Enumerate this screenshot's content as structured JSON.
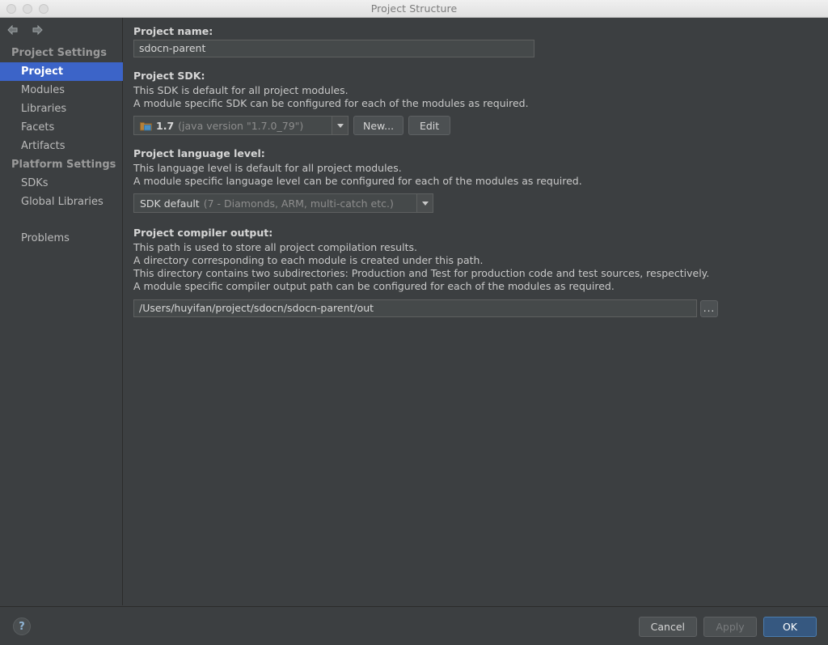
{
  "window": {
    "title": "Project Structure",
    "traffic_lights": [
      "close-button",
      "minimize-button",
      "zoom-button"
    ]
  },
  "nav": {
    "back_label": "Back",
    "forward_label": "Forward"
  },
  "sidebar": {
    "groups": [
      {
        "label": "Project Settings",
        "items": [
          {
            "label": "Project",
            "selected": true
          },
          {
            "label": "Modules",
            "selected": false
          },
          {
            "label": "Libraries",
            "selected": false
          },
          {
            "label": "Facets",
            "selected": false
          },
          {
            "label": "Artifacts",
            "selected": false
          }
        ]
      },
      {
        "label": "Platform Settings",
        "items": [
          {
            "label": "SDKs",
            "selected": false
          },
          {
            "label": "Global Libraries",
            "selected": false
          }
        ]
      }
    ],
    "problems_label": "Problems"
  },
  "main": {
    "project_name": {
      "label": "Project name:",
      "value": "sdocn-parent"
    },
    "project_sdk": {
      "label": "Project SDK:",
      "desc_lines": [
        "This SDK is default for all project modules.",
        "A module specific SDK can be configured for each of the modules as required."
      ],
      "selected_version": "1.7",
      "selected_detail": "(java version \"1.7.0_79\")",
      "new_button": "New...",
      "edit_button": "Edit"
    },
    "language_level": {
      "label": "Project language level:",
      "desc_lines": [
        "This language level is default for all project modules.",
        "A module specific language level can be configured for each of the modules as required."
      ],
      "selected": "SDK default",
      "selected_detail": "(7 - Diamonds, ARM, multi-catch etc.)"
    },
    "compiler_output": {
      "label": "Project compiler output:",
      "desc_lines": [
        "This path is used to store all project compilation results.",
        "A directory corresponding to each module is created under this path.",
        "This directory contains two subdirectories: Production and Test for production code and test sources, respectively.",
        "A module specific compiler output path can be configured for each of the modules as required."
      ],
      "path": "/Users/huyifan/project/sdocn/sdocn-parent/out",
      "browse_button": "..."
    }
  },
  "footer": {
    "help_label": "?",
    "cancel_label": "Cancel",
    "apply_label": "Apply",
    "ok_label": "OK"
  },
  "colors": {
    "background": "#3c3f41",
    "selection_blue": "#3c64c8",
    "primary_button": "#365880",
    "field_background": "#45494a",
    "text": "#d6d6d6"
  }
}
